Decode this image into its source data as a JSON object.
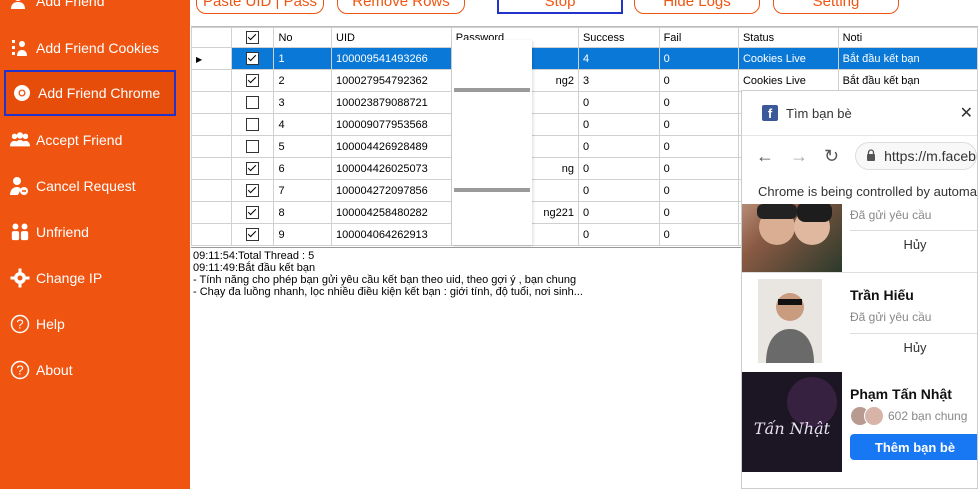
{
  "sidebar": {
    "items": [
      {
        "label": "Add Friend",
        "icon": "user-plus-icon"
      },
      {
        "label": "Add Friend Cookies",
        "icon": "cookie-icon"
      },
      {
        "label": "Add Friend Chrome",
        "icon": "chrome-icon",
        "active": true
      },
      {
        "label": "Accept Friend",
        "icon": "users-icon"
      },
      {
        "label": "Cancel Request",
        "icon": "user-cancel-icon"
      },
      {
        "label": "Unfriend",
        "icon": "unfriend-icon"
      },
      {
        "label": "Change IP",
        "icon": "gear-icon"
      },
      {
        "label": "Help",
        "icon": "help-icon"
      },
      {
        "label": "About",
        "icon": "about-icon"
      }
    ]
  },
  "toolbar": {
    "paste": "Paste UID | Pass",
    "remove": "Remove Rows",
    "stop": "Stop",
    "hide_logs": "Hide Logs",
    "setting": "Setting"
  },
  "table": {
    "columns": [
      "No",
      "UID",
      "Password",
      "Success",
      "Fail",
      "Status",
      "Noti"
    ],
    "rows": [
      {
        "checked": true,
        "no": "1",
        "uid": "100009541493266",
        "pw": "",
        "success": "4",
        "fail": "0",
        "status": "Cookies Live",
        "noti": "Bắt đầu kết bạn"
      },
      {
        "checked": true,
        "no": "2",
        "uid": "100027954792362",
        "pw": "ng2",
        "success": "3",
        "fail": "0",
        "status": "Cookies Live",
        "noti": "Bắt đầu kết bạn"
      },
      {
        "checked": false,
        "no": "3",
        "uid": "100023879088721",
        "pw": "",
        "success": "0",
        "fail": "0",
        "status": "",
        "noti": ""
      },
      {
        "checked": false,
        "no": "4",
        "uid": "100009077953568",
        "pw": "",
        "success": "0",
        "fail": "0",
        "status": "",
        "noti": ""
      },
      {
        "checked": false,
        "no": "5",
        "uid": "100004426928489",
        "pw": "",
        "success": "0",
        "fail": "0",
        "status": "",
        "noti": ""
      },
      {
        "checked": true,
        "no": "6",
        "uid": "100004426025073",
        "pw": "ng",
        "success": "0",
        "fail": "0",
        "status": "",
        "noti": ""
      },
      {
        "checked": true,
        "no": "7",
        "uid": "100004272097856",
        "pw": "",
        "success": "0",
        "fail": "0",
        "status": "",
        "noti": ""
      },
      {
        "checked": true,
        "no": "8",
        "uid": "100004258480282",
        "pw": "ng221",
        "success": "0",
        "fail": "0",
        "status": "",
        "noti": ""
      },
      {
        "checked": true,
        "no": "9",
        "uid": "100004064262913",
        "pw": "",
        "success": "0",
        "fail": "0",
        "status": "",
        "noti": ""
      }
    ]
  },
  "logs": [
    "09:11:54:Total Thread : 5",
    "09:11:49:Bắt đầu kết bạn",
    "- Tính năng cho phép bạn gửi yêu cầu kết bạn theo uid, theo gợi ý , bạn chung",
    "- Chạy đa luồng nhanh, lọc nhiều điều kiện kết bạn : giới tính, độ tuổi, nơi sinh..."
  ],
  "chrome": {
    "tab_title": "Tìm bạn bè",
    "url": "https://m.faceb",
    "info_bar": "Chrome is being controlled by automa",
    "cards": [
      {
        "name": "",
        "sub": "Đã gửi yêu cầu",
        "button": "Hủy"
      },
      {
        "name": "Trần Hiếu",
        "sub": "Đã gửi yêu cầu",
        "button": "Hủy"
      },
      {
        "name": "Phạm Tấn Nhật",
        "sub": "602 bạn chung",
        "button": "Thêm bạn bè",
        "thumb_text": "Tấn Nhật"
      }
    ]
  },
  "colors": {
    "accent": "#ef5511",
    "highlight": "#2233cc",
    "selection": "#0a78d7",
    "facebook": "#1877f2"
  }
}
